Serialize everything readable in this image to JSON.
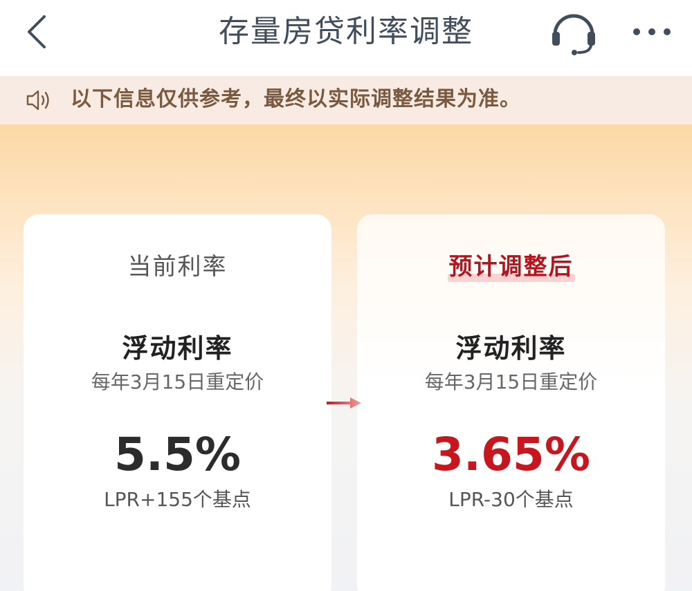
{
  "header": {
    "title": "存量房贷利率调整",
    "back_icon": "chevron-left-icon",
    "service_icon": "headset-icon",
    "more_icon": "more-dots-icon"
  },
  "notice": {
    "icon": "speaker-icon",
    "text": "以下信息仅供参考，最终以实际调整结果为准。"
  },
  "cards": {
    "current": {
      "heading": "当前利率",
      "rate_type": "浮动利率",
      "reset_note": "每年3月15日重定价",
      "rate": "5.5%",
      "spread": "LPR+155个基点"
    },
    "adjusted": {
      "heading": "预计调整后",
      "rate_type": "浮动利率",
      "reset_note": "每年3月15日重定价",
      "rate": "3.65%",
      "spread": "LPR-30个基点"
    }
  },
  "colors": {
    "accent_red": "#c8161e",
    "title_gray": "#3f4d5c",
    "notice_bg": "#f8ebe4",
    "notice_text": "#7a5a3e",
    "gradient_top": "#fcd8a6"
  }
}
